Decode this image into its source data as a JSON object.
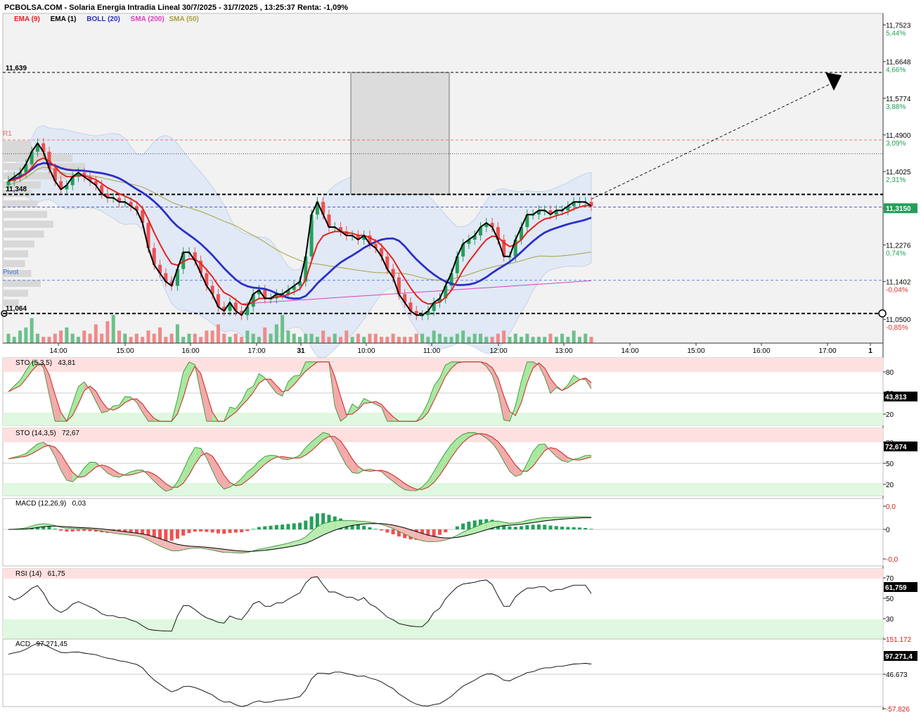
{
  "header": {
    "title": "PCBOLSA.COM - Solaria Energia Intradia Lineal 30/7/2025 - 31/7/2025 , 13:25:37 Renta: -1,09%"
  },
  "legend": {
    "ema9": "EMA (9)",
    "ema1": "EMA (1)",
    "boll": "BOLL (20)",
    "sma200": "SMA (200)",
    "sma50": "SMA (50)"
  },
  "colors": {
    "ema9": "#e8201c",
    "ema1": "#000000",
    "boll": "#2e2ec8",
    "sma200": "#e040c0",
    "sma50": "#a8a040",
    "up": "#22a05a",
    "down": "#f05050",
    "bollBand": "#dfe9f6",
    "last": "#22a05a"
  },
  "price_axis": {
    "ticks": [
      {
        "price": "11,7523",
        "pct": "5,44%"
      },
      {
        "price": "11,6648",
        "pct": "4,66%"
      },
      {
        "price": "11,5774",
        "pct": "3,88%"
      },
      {
        "price": "11,4900",
        "pct": "3,09%"
      },
      {
        "price": "11,4025",
        "pct": "2,31%"
      },
      {
        "price": "11,3151",
        "pct": ""
      },
      {
        "price": "11,2276",
        "pct": "0,74%"
      },
      {
        "price": "11,1402",
        "pct": "-0,04%"
      },
      {
        "price": "11,0500",
        "pct": "-0,85%"
      }
    ],
    "last_price": "11,3150"
  },
  "levels": {
    "resistance": "11,639",
    "r1_label": "R1",
    "level_mid": "11,348",
    "pivot_label": "Pivot",
    "support": "11,064"
  },
  "time_axis": {
    "labels": [
      "14:00",
      "15:00",
      "16:00",
      "17:00",
      "31",
      "10:00",
      "11:00",
      "12:00",
      "13:00",
      "14:00",
      "15:00",
      "16:00",
      "17:00",
      "1"
    ]
  },
  "panels": {
    "sto_fast": {
      "label": "STO (5,3,5)",
      "value": "43,81",
      "last": "43,813",
      "ticks": [
        "80",
        "50",
        "20"
      ]
    },
    "sto_slow": {
      "label": "STO (14,3,5)",
      "value": "72,67",
      "last": "72,674",
      "ticks": [
        "80",
        "50",
        "20"
      ]
    },
    "macd": {
      "label": "MACD (12,26,9)",
      "value": "0,03",
      "ticks": [
        "0,0",
        "0",
        "-0,0"
      ]
    },
    "rsi": {
      "label": "RSI (14)",
      "value": "61,75",
      "last": "61,759",
      "ticks": [
        "70",
        "50",
        "30"
      ]
    },
    "acd": {
      "label": "ACD",
      "value": "97.271,45",
      "last": "97.271,4",
      "ticks": [
        "151.172",
        "46.673",
        "-57.826"
      ]
    }
  },
  "chart_data": {
    "type": "candlestick",
    "title": "Solaria Energia Intradia Lineal 30/7/2025 - 31/7/2025 , 13:25:37 Renta: -1,09%",
    "ylim": [
      11.0,
      11.78
    ],
    "close": [
      11.38,
      11.39,
      11.4,
      11.42,
      11.45,
      11.47,
      11.45,
      11.41,
      11.38,
      11.36,
      11.37,
      11.39,
      11.4,
      11.39,
      11.38,
      11.37,
      11.35,
      11.34,
      11.34,
      11.33,
      11.33,
      11.32,
      11.31,
      11.28,
      11.22,
      11.18,
      11.16,
      11.14,
      11.13,
      11.17,
      11.21,
      11.21,
      11.19,
      11.16,
      11.13,
      11.11,
      11.08,
      11.07,
      11.09,
      11.07,
      11.06,
      11.08,
      11.11,
      11.12,
      11.1,
      11.1,
      11.11,
      11.11,
      11.12,
      11.13,
      11.14,
      11.2,
      11.3,
      11.33,
      11.3,
      11.27,
      11.27,
      11.26,
      11.25,
      11.25,
      11.24,
      11.25,
      11.23,
      11.22,
      11.2,
      11.17,
      11.15,
      11.11,
      11.09,
      11.07,
      11.06,
      11.06,
      11.07,
      11.09,
      11.1,
      11.13,
      11.16,
      11.2,
      11.23,
      11.24,
      11.25,
      11.27,
      11.28,
      11.27,
      11.24,
      11.2,
      11.2,
      11.24,
      11.27,
      11.3,
      11.3,
      11.31,
      11.31,
      11.3,
      11.31,
      11.31,
      11.32,
      11.33,
      11.33,
      11.33,
      11.32
    ],
    "volume": [
      3,
      2,
      4,
      5,
      8,
      3,
      2,
      2,
      3,
      4,
      5,
      3,
      2,
      4,
      3,
      6,
      3,
      7,
      9,
      4,
      3,
      2,
      3,
      2,
      4,
      3,
      5,
      2,
      3,
      6,
      2,
      3,
      3,
      2,
      4,
      4,
      6,
      3,
      2,
      3,
      2,
      4,
      3,
      2,
      5,
      3,
      6,
      9,
      4,
      3,
      2,
      3,
      3,
      2,
      4,
      2,
      3,
      2,
      4,
      2,
      3,
      2,
      3,
      3,
      2,
      2,
      3,
      2,
      2,
      2,
      3,
      3,
      2,
      4,
      3,
      2,
      2,
      3,
      4,
      2,
      3,
      3,
      2,
      2,
      3,
      4,
      2,
      3,
      2,
      3,
      2,
      2,
      2,
      3,
      2,
      3,
      2,
      4,
      2,
      3,
      2
    ],
    "ema9": [],
    "boll_mid": [],
    "sma50": [],
    "sma200": [],
    "levels": {
      "resistance": 11.639,
      "r1": 11.478,
      "level_mid": 11.348,
      "pivot": 11.143,
      "support": 11.064,
      "blue_dash": 11.318,
      "dotted": 11.445
    },
    "target_box": {
      "from_time": "09:55",
      "to_time": "10:40",
      "low": 11.348,
      "high": 11.639
    },
    "sto_fast": {
      "k": [],
      "d": []
    },
    "sto_slow": {
      "k": [],
      "d": []
    },
    "macd": {
      "hist": [],
      "signal": []
    },
    "rsi": [],
    "acd": []
  }
}
